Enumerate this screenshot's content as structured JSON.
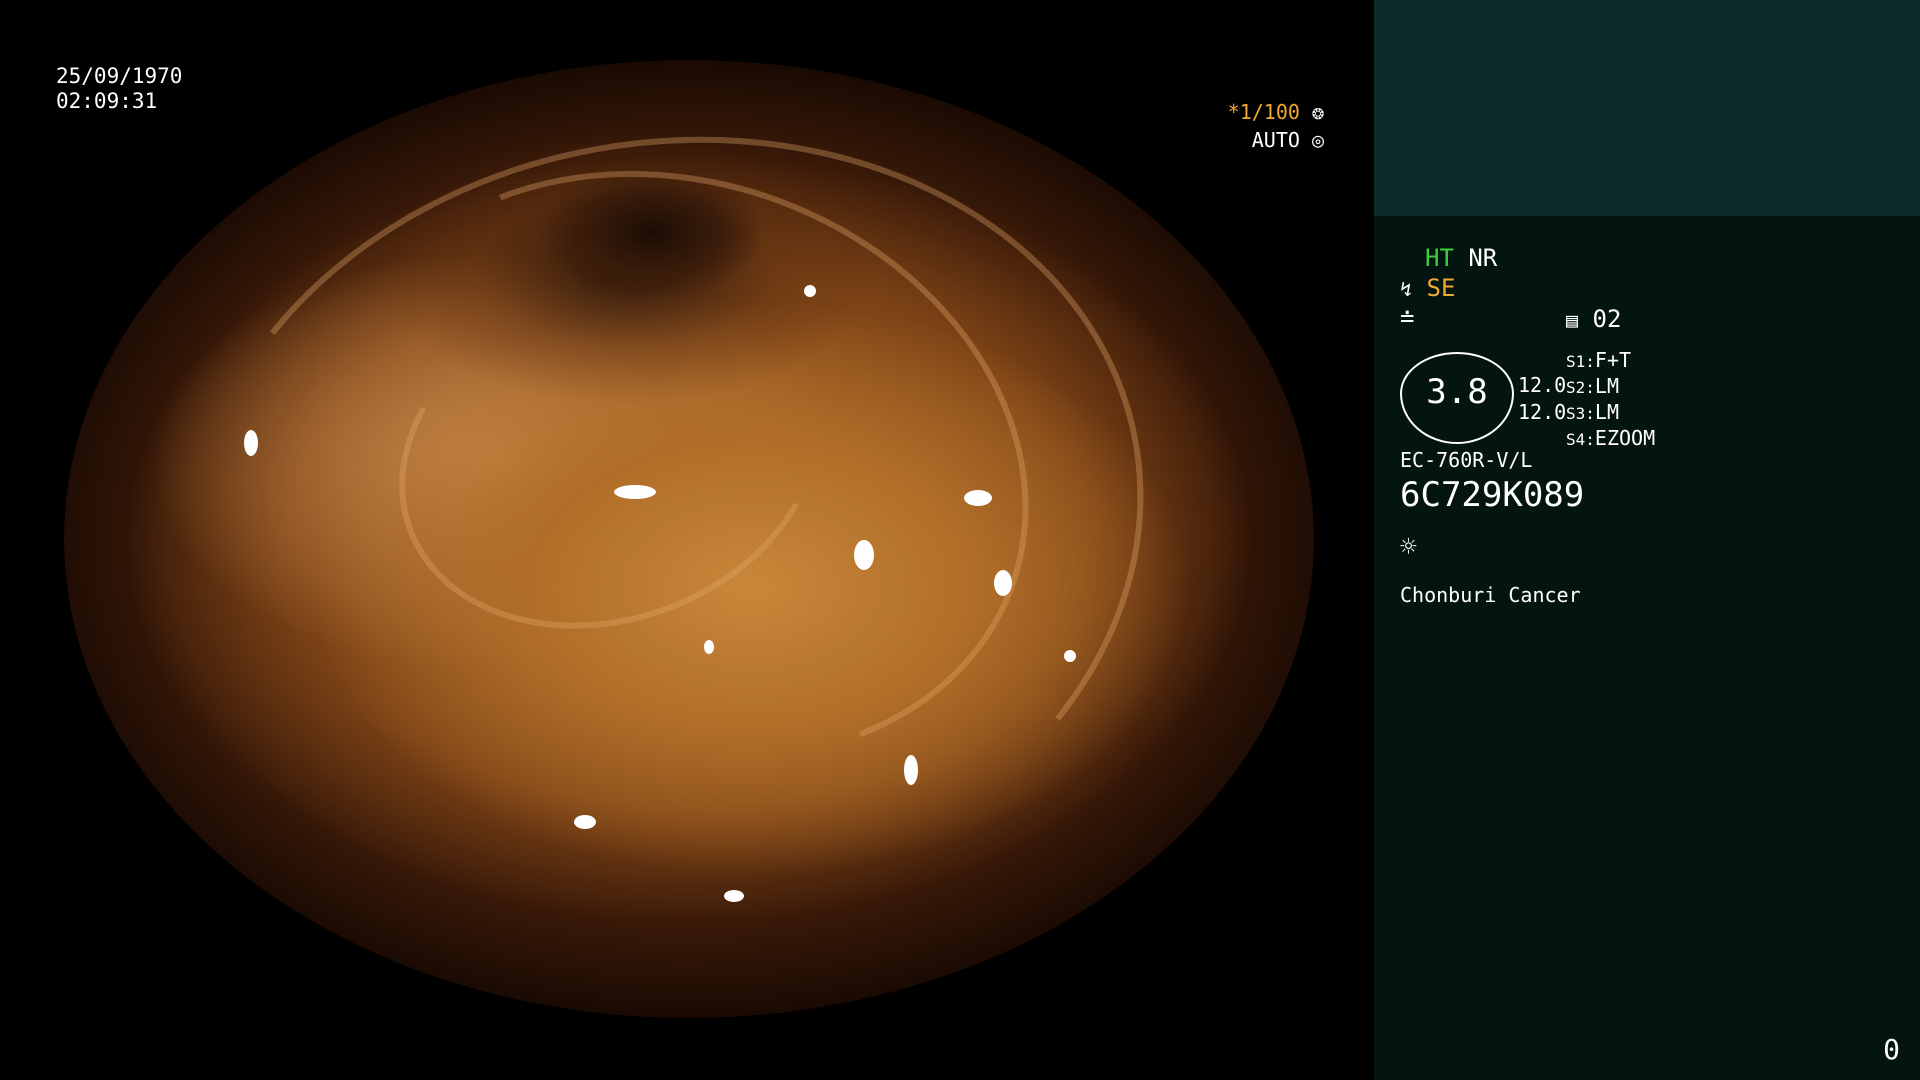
{
  "overlay": {
    "date": "25/09/1970",
    "time": "02:09:31",
    "shutter_speed": "*1/100",
    "shutter_icon": "aperture-icon",
    "iris_mode": "AUTO",
    "iris_icon": "iris-icon"
  },
  "panel": {
    "ht": "HT",
    "nr": "NR",
    "se": "SE",
    "memory_number": "02",
    "zoom": "3.8",
    "value_1": "12.0",
    "value_2": "12.0",
    "switches": [
      {
        "key": "S1:",
        "value": "F+T"
      },
      {
        "key": "S2:",
        "value": "LM"
      },
      {
        "key": "S3:",
        "value": "LM"
      },
      {
        "key": "S4:",
        "value": "EZOOM"
      }
    ],
    "scope_model": "EC-760R-V/L",
    "serial": "6C729K089",
    "hospital": "Chonburi Cancer",
    "counter": "0"
  },
  "colors": {
    "panel_top": "#0e2b2b",
    "panel_bottom": "#041410",
    "ht_green": "#3ecf3e",
    "accent_orange": "#f0a830"
  }
}
